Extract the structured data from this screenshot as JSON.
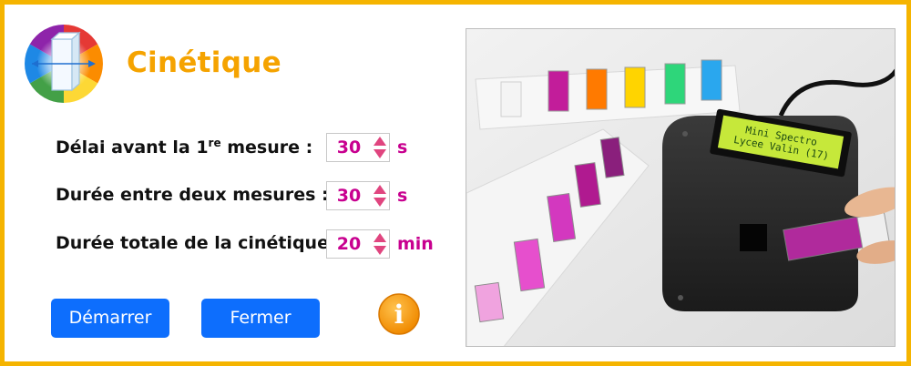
{
  "header": {
    "title": "Cinétique"
  },
  "form": {
    "rows": [
      {
        "label_pre": "Délai avant la 1",
        "label_sup": "re",
        "label_post": " mesure :",
        "value": "30",
        "unit": "s"
      },
      {
        "label": "Durée entre deux mesures :",
        "value": "30",
        "unit": "s"
      },
      {
        "label": "Durée totale de la cinétique :",
        "value": "20",
        "unit": "min"
      }
    ]
  },
  "buttons": {
    "start_label": "Démarrer",
    "close_label": "Fermer",
    "info_label": "i"
  },
  "photo": {
    "lcd_line1": "Mini Spectro",
    "lcd_line2": "Lycee Valin (17)"
  },
  "colors": {
    "frame": "#f5b400",
    "title": "#f5a300",
    "value": "#c8008f",
    "button": "#0d6efd",
    "info": "#f59400"
  },
  "icons": [
    "spectrum-cuvette-logo",
    "spin-up-arrow",
    "spin-down-arrow",
    "info-icon"
  ]
}
